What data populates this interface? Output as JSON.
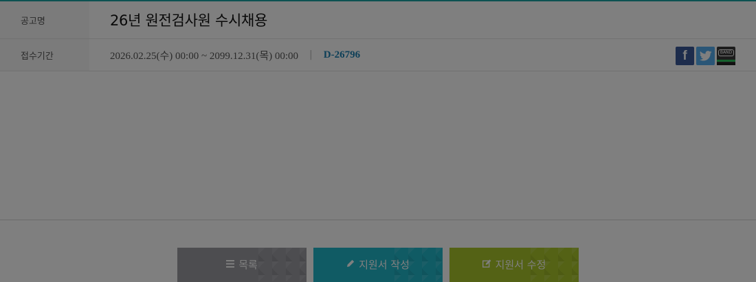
{
  "posting": {
    "title_label": "공고명",
    "title": "26년 원전검사원 수시채용",
    "period_label": "접수기간",
    "period": "2026.02.25(수) 00:00 ~ 2099.12.31(목) 00:00",
    "separator": "|",
    "dday": "D-26796"
  },
  "share": {
    "facebook_glyph": "f",
    "band_label": "BAND",
    "colors": {
      "facebook": "#3b5998",
      "twitter": "#55acee",
      "band": "#2bc25a"
    }
  },
  "actions": {
    "list_label": "목록",
    "write_label": "지원서 작성",
    "edit_label": "지원서 수정",
    "icons": {
      "list": "list-icon",
      "write": "pencil-icon",
      "edit": "edit-icon"
    }
  },
  "colors": {
    "accent": "#1aa3a3",
    "dday": "#1a7fb0",
    "list_button": "#9a9aa0",
    "write_button": "#20b6c8",
    "edit_button": "#a8c52a"
  }
}
